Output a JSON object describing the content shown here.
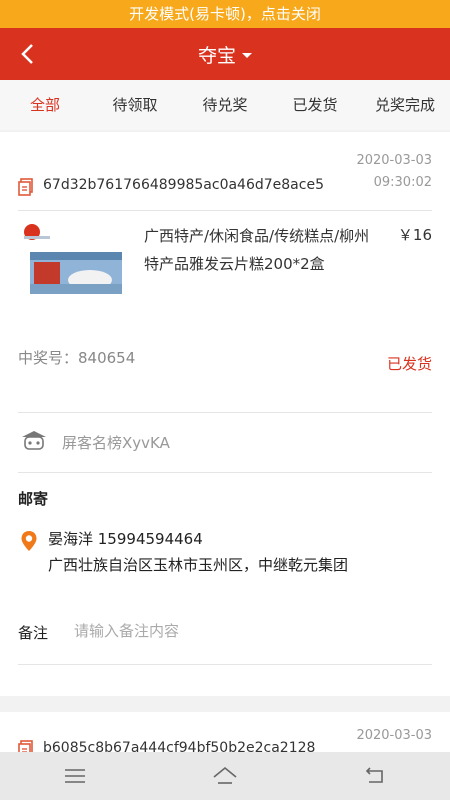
{
  "dev_banner": "开发模式(易卡顿)，点击关闭",
  "header": {
    "title": "夺宝"
  },
  "tabs": [
    {
      "label": "全部"
    },
    {
      "label": "待领取"
    },
    {
      "label": "待兑奖"
    },
    {
      "label": "已发货"
    },
    {
      "label": "兑奖完成"
    }
  ],
  "orders": [
    {
      "id": "67d32b761766489985ac0a46d7e8ace5",
      "date": "2020-03-03",
      "time": "09:30:02",
      "product_name": "广西特产/休闲食品/传统糕点/柳州特产品雅发云片糕200*2盒",
      "price": "￥16",
      "win_label": "中奖号：840654",
      "status": "已发货",
      "rank_text": "屏客名榜XyvKA",
      "mail_title": "邮寄",
      "recipient": "晏海洋   15994594464",
      "address": "广西壮族自治区玉林市玉州区，中继乾元集团",
      "note_label": "备注",
      "note_placeholder": "请输入备注内容"
    },
    {
      "id": "b6085c8b67a444cf94bf50b2e2ca2128",
      "date": "2020-03-03"
    }
  ]
}
